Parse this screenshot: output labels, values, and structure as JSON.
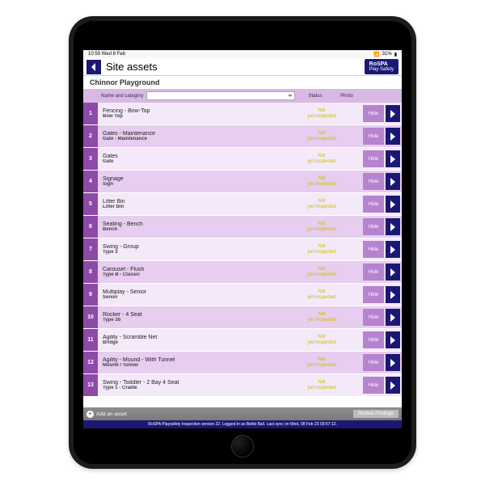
{
  "status_bar": {
    "time": "10:59  Wed 8 Feb",
    "battery": "31%"
  },
  "topbar": {
    "title": "Site assets",
    "logo_line1": "RoSPA",
    "logo_line2": "Play Safety"
  },
  "subtitle": "Chinnor Playground",
  "columns": {
    "name": "Name and category",
    "status": "Status",
    "photo": "Photo"
  },
  "status_label": "Not yet inspected",
  "hide_label": "Hide",
  "assets": [
    {
      "n": "1",
      "name": "Fencing - Bow-Top",
      "cat": "Bow Top"
    },
    {
      "n": "2",
      "name": "Gates - Maintenance",
      "cat": "Gate - Maintenance"
    },
    {
      "n": "3",
      "name": "Gates",
      "cat": "Gate"
    },
    {
      "n": "4",
      "name": "Signage",
      "cat": "Sign"
    },
    {
      "n": "5",
      "name": "Litter Bin",
      "cat": "Litter Bin"
    },
    {
      "n": "6",
      "name": "Seating - Bench",
      "cat": "Bench"
    },
    {
      "n": "7",
      "name": "Swing - Group",
      "cat": "Type 3"
    },
    {
      "n": "8",
      "name": "Carousel - Flush",
      "cat": "Type B - Classic"
    },
    {
      "n": "9",
      "name": "Multiplay - Senior",
      "cat": "Senior"
    },
    {
      "n": "10",
      "name": "Rocker - 4 Seat",
      "cat": "Type 3b"
    },
    {
      "n": "11",
      "name": "Agility - Scramble Net",
      "cat": "Bridge"
    },
    {
      "n": "12",
      "name": "Agility - Mound - With Tunnel",
      "cat": "Mound / Tunnel"
    },
    {
      "n": "13",
      "name": "Swing - Toddler - 2 Bay 4 Seat",
      "cat": "Type 1 - Cradle"
    }
  ],
  "bottom": {
    "add": "Add an asset",
    "review": "Review Findings"
  },
  "footer": "RoSPA Playsafety Inspection version 22. Logged in as Bekki Ball. Last sync on Wed, 08 Feb 23 09:57:12."
}
